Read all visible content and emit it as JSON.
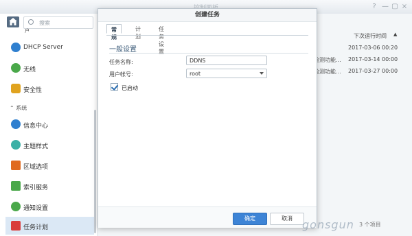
{
  "window": {
    "title": "控制面板",
    "btn_help": "?",
    "btn_min": "—",
    "btn_max": "▢",
    "btn_close": "×"
  },
  "sidebar": {
    "search_placeholder": "搜索",
    "partial_top": "户",
    "items": [
      {
        "label": "DHCP Server",
        "icon": "dhcp-server-icon",
        "color": "#2f7fcf"
      },
      {
        "label": "无线",
        "icon": "wifi-icon",
        "color": "#4aa84a"
      },
      {
        "label": "安全性",
        "icon": "shield-icon",
        "color": "#e0a31f"
      }
    ],
    "section_system": "系统",
    "system_items": [
      {
        "label": "信息中心",
        "icon": "info-icon",
        "color": "#2f7fcf"
      },
      {
        "label": "主题样式",
        "icon": "palette-icon",
        "color": "#3bb0a6"
      },
      {
        "label": "区域选项",
        "icon": "calendar-icon",
        "color": "#e06a1f"
      },
      {
        "label": "索引服务",
        "icon": "search-index-icon",
        "color": "#4aa84a"
      },
      {
        "label": "通知设置",
        "icon": "chat-icon",
        "color": "#4aa84a"
      },
      {
        "label": "任务计划",
        "icon": "task-scheduler-icon",
        "color": "#d93c3c"
      }
    ]
  },
  "main": {
    "col_next_run": "下次运行时间",
    "rows": [
      {
        "prefix": "",
        "date": "2017-03-06 00:20"
      },
      {
        "prefix": "检测功能...",
        "date": "2017-03-14 00:00"
      },
      {
        "prefix": "检测功能...",
        "date": "2017-03-27 00:00"
      }
    ],
    "pager": "3 个项目"
  },
  "dialog": {
    "title": "创建任务",
    "tabs": [
      "常规",
      "计划",
      "任务设置"
    ],
    "section": "一般设置",
    "task_name_label": "任务名称:",
    "task_name_value": "DDNS",
    "user_label": "用户帐号:",
    "user_value": "root",
    "enabled_label": "已启动",
    "enabled": true,
    "ok_label": "确定",
    "cancel_label": "取消"
  },
  "watermark": "gonsgun"
}
